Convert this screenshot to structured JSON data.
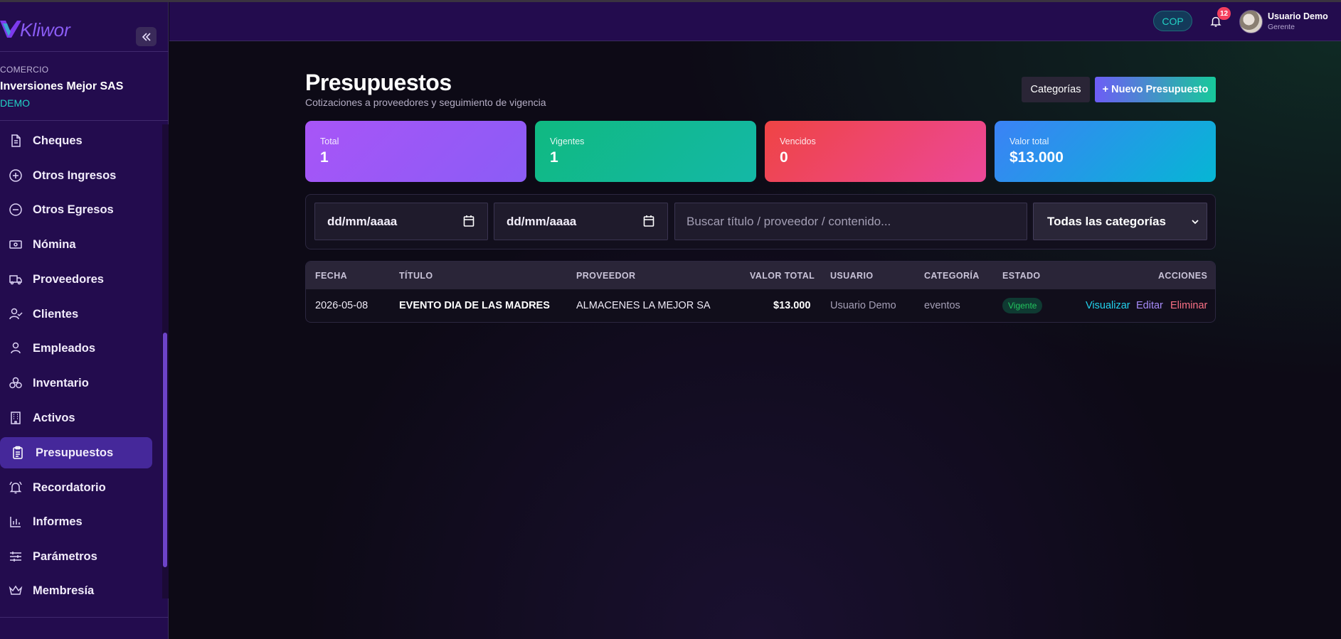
{
  "app": {
    "brand": "Kliwor",
    "colors": {
      "sidebar": "#230c4e",
      "accent": "#7c3aed",
      "teal": "#22d3c5"
    }
  },
  "sidebar": {
    "company_label": "COMERCIO",
    "company_name": "Inversiones Mejor SAS",
    "company_plan": "DEMO",
    "items": [
      {
        "label": "Cheques",
        "icon": "document-icon"
      },
      {
        "label": "Otros Ingresos",
        "icon": "plus-circle-icon"
      },
      {
        "label": "Otros Egresos",
        "icon": "minus-circle-icon"
      },
      {
        "label": "Nómina",
        "icon": "banknote-icon"
      },
      {
        "label": "Proveedores",
        "icon": "truck-icon"
      },
      {
        "label": "Clientes",
        "icon": "user-check-icon"
      },
      {
        "label": "Empleados",
        "icon": "user-icon"
      },
      {
        "label": "Inventario",
        "icon": "boxes-icon"
      },
      {
        "label": "Activos",
        "icon": "building-icon"
      },
      {
        "label": "Presupuestos",
        "icon": "clipboard-icon",
        "active": true
      },
      {
        "label": "Recordatorio",
        "icon": "bell-ring-icon"
      },
      {
        "label": "Informes",
        "icon": "bar-chart-icon"
      },
      {
        "label": "Parámetros",
        "icon": "sliders-icon"
      },
      {
        "label": "Membresía",
        "icon": "crown-icon"
      }
    ]
  },
  "header": {
    "currency": "COP",
    "notifications": "12",
    "user_name": "Usuario Demo",
    "user_role": "Gerente"
  },
  "page": {
    "title": "Presupuestos",
    "subtitle": "Cotizaciones a proveedores y seguimiento de vigencia",
    "btn_categorias": "Categorías",
    "btn_nuevo": "+ Nuevo Presupuesto"
  },
  "stats": [
    {
      "label": "Total",
      "value": "1",
      "color": "#8b5cf6"
    },
    {
      "label": "Vigentes",
      "value": "1",
      "color": "#10b981"
    },
    {
      "label": "Vencidos",
      "value": "0",
      "color": "#f43f5e"
    },
    {
      "label": "Valor total",
      "value": "$13.000",
      "color": "#0ea5e9"
    }
  ],
  "filters": {
    "date_from": "dd/mm/aaaa",
    "date_to": "dd/mm/aaaa",
    "search_placeholder": "Buscar título / proveedor / contenido...",
    "category_selected": "Todas las categorías"
  },
  "table": {
    "headers": [
      "FECHA",
      "TÍTULO",
      "PROVEEDOR",
      "VALOR TOTAL",
      "USUARIO",
      "CATEGORÍA",
      "ESTADO",
      "ACCIONES"
    ],
    "rows": [
      {
        "fecha": "2026-05-08",
        "titulo": "EVENTO DIA DE LAS MADRES",
        "proveedor": "ALMACENES LA MEJOR SA",
        "valor": "$13.000",
        "usuario": "Usuario Demo",
        "categoria": "eventos",
        "estado": "Vigente",
        "acciones": {
          "ver": "Visualizar",
          "editar": "Editar",
          "eliminar": "Eliminar"
        }
      }
    ]
  }
}
